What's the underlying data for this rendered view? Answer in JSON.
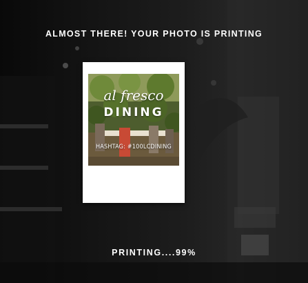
{
  "screen": {
    "headline": "ALMOST THERE! YOUR PHOTO IS PRINTING",
    "status": "PRINTING....99%",
    "progress_percent": 99
  },
  "print": {
    "photo_title": "al fresco",
    "photo_subtitle": "DINING",
    "photo_hashtag": "HASHTAG: #100LCDINING"
  },
  "colors": {
    "text": "#ffffff",
    "background": "#0b0b0b",
    "print_border": "#ffffff"
  }
}
